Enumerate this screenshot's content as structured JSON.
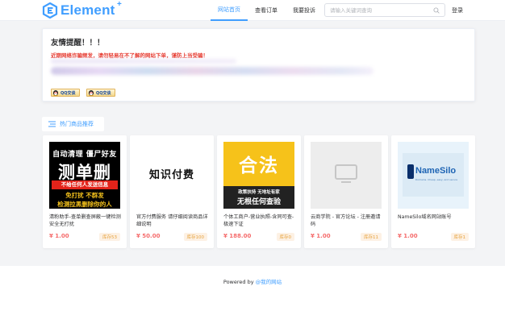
{
  "header": {
    "logo_text": "Element",
    "logo_plus": "+",
    "nav": [
      {
        "label": "网站首页",
        "active": true
      },
      {
        "label": "查看订单",
        "active": false
      },
      {
        "label": "我要投诉",
        "active": false
      }
    ],
    "search_placeholder": "请输入关键词查询",
    "login_label": "登录"
  },
  "notice": {
    "title": "友情提醒！！！",
    "warning": "近期网络诈骗频发，请勿轻易在不了解的网站下单，谨防上当受骗！",
    "qq_buttons": [
      "QQ交谈",
      "QQ交谈"
    ]
  },
  "hot": {
    "label": "热门商品推荐"
  },
  "products": [
    {
      "name": "清粉助手-查单删查屏蔽一键检测安全无打扰",
      "price": "¥ 1.00",
      "stock": "库存53",
      "thumb": {
        "l1": "自动清理 僵尸好友",
        "l2": "测单删",
        "l3": "不给任何人发送信息",
        "l4": "免打扰 不群发",
        "l5": "检测拉黑删除你的人"
      }
    },
    {
      "name": "官方付费服务 请仔细阅读商品详细说明",
      "price": "¥ 50.00",
      "stock": "库存100",
      "thumb": {
        "text": "知识付费"
      }
    },
    {
      "name": "个体工商户-营业执照-含同可查-极速下证",
      "price": "¥ 188.00",
      "stock": "库存0",
      "thumb": {
        "big": "合法",
        "b1": "政策扶持 无地址有家",
        "b2": "无根任何查验"
      }
    },
    {
      "name": "云商学院 - 官方论坛 - 注册邀请码",
      "price": "¥ 1.00",
      "stock": "库存11",
      "thumb": {}
    },
    {
      "name": "NameSilo域名网站账号",
      "price": "¥ 1.00",
      "stock": "库存1",
      "thumb": {
        "brand": "NameSilo",
        "sub": "Domains. Cheap, easy, and secure"
      }
    }
  ],
  "footer": {
    "prefix": "Powered by ",
    "link": "@我的网站"
  },
  "colors": {
    "accent": "#409eff",
    "price": "#f56c6c",
    "stock_text": "#e6a23c",
    "warning": "#e6372c"
  }
}
